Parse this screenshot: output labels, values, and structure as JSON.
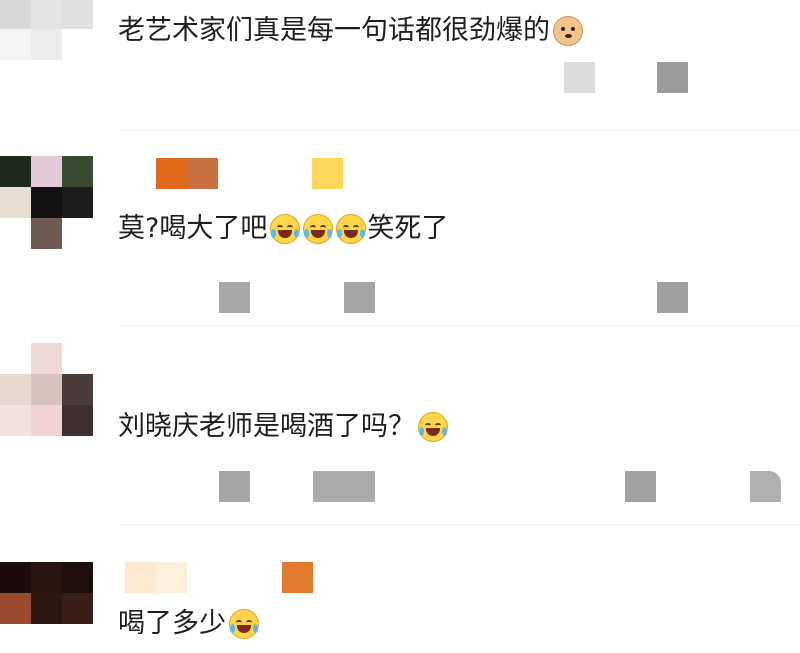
{
  "comments": [
    {
      "text": "老艺术家们真是每一句话都很劲爆的",
      "emojis": [
        "doge-icon"
      ]
    },
    {
      "text_before": "莫?喝大了吧",
      "emojis": [
        "laugh-cry-icon",
        "laugh-cry-icon",
        "laugh-cry-icon"
      ],
      "text_after": "笑死了"
    },
    {
      "text": "刘晓庆老师是喝酒了吗？",
      "emojis": [
        "laugh-cry-icon"
      ]
    },
    {
      "text": "喝了多少",
      "emojis": [
        "laugh-cry-icon"
      ]
    }
  ]
}
